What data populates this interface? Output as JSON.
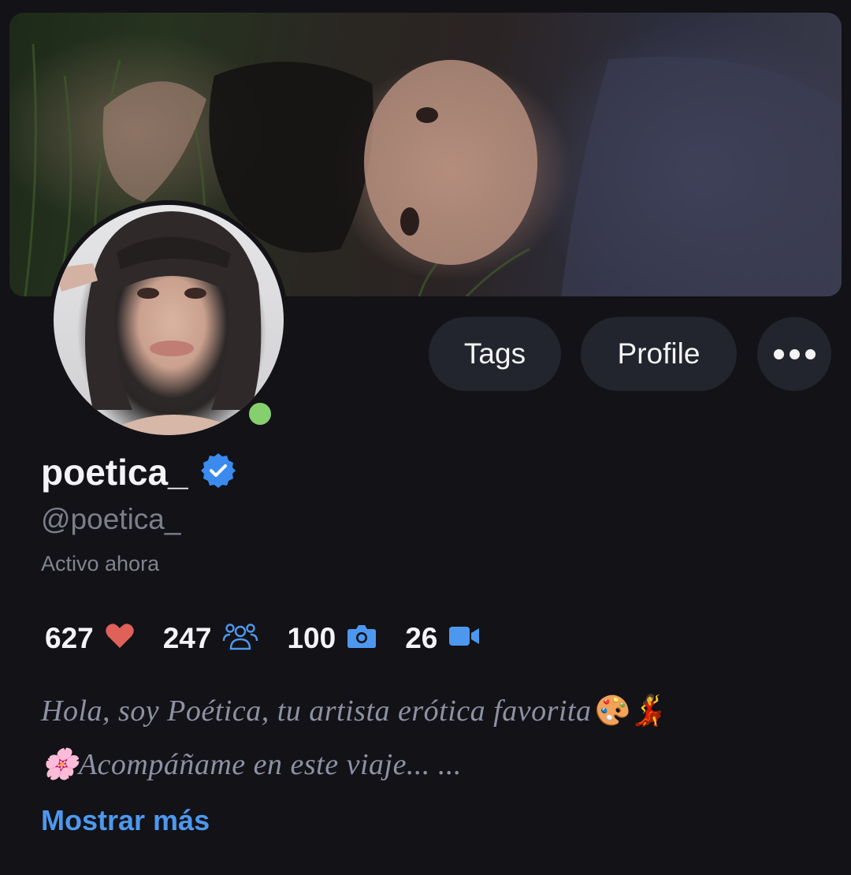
{
  "profile": {
    "display_name": "poetica_",
    "handle": "@poetica_",
    "activity": "Activo ahora",
    "verified": true,
    "online": true
  },
  "actions": {
    "tags_label": "Tags",
    "profile_label": "Profile",
    "more_icon": "more-horizontal-icon"
  },
  "stats": [
    {
      "value": "627",
      "icon": "heart-icon"
    },
    {
      "value": "247",
      "icon": "people-icon"
    },
    {
      "value": "100",
      "icon": "camera-icon"
    },
    {
      "value": "26",
      "icon": "video-camera-icon"
    }
  ],
  "bio": {
    "line1": "Hola, soy Poética, tu artista erótica favorita🎨💃",
    "line2": "🌸Acompáñame en este viaje... ...",
    "show_more_label": "Mostrar más"
  },
  "colors": {
    "background": "#121217",
    "button_bg": "#22252d",
    "accent": "#4d98ee",
    "verified_badge": "#3b8bef",
    "online_dot": "#86cf6f",
    "heart": "#e0605a",
    "muted_text": "#7b7f8c"
  }
}
